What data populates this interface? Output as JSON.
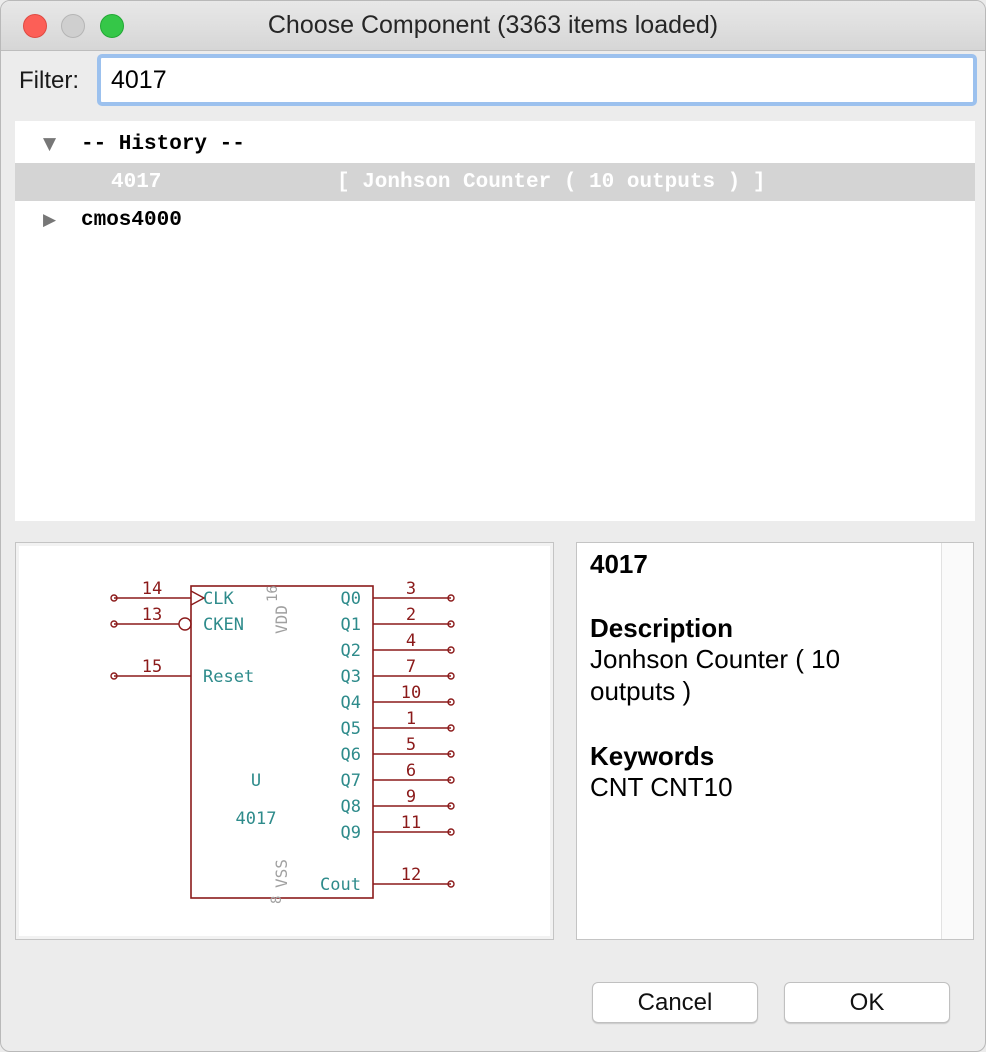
{
  "window": {
    "title": "Choose Component (3363 items loaded)"
  },
  "filter": {
    "label": "Filter:",
    "value": "4017"
  },
  "tree": {
    "history_label": "-- History --",
    "history_item": {
      "name": "4017",
      "description": "[ Jonhson Counter ( 10 outputs ) ]"
    },
    "library_label": "cmos4000"
  },
  "symbol": {
    "reference": "U",
    "value": "4017",
    "power_pins": {
      "vdd_name": "VDD",
      "vdd_number": "16",
      "vss_name": "VSS",
      "vss_number": "8"
    },
    "left_pins": [
      {
        "number": "14",
        "name": "CLK"
      },
      {
        "number": "13",
        "name": "CKEN"
      },
      {
        "number": "15",
        "name": "Reset"
      }
    ],
    "right_pins": [
      {
        "number": "3",
        "name": "Q0"
      },
      {
        "number": "2",
        "name": "Q1"
      },
      {
        "number": "4",
        "name": "Q2"
      },
      {
        "number": "7",
        "name": "Q3"
      },
      {
        "number": "10",
        "name": "Q4"
      },
      {
        "number": "1",
        "name": "Q5"
      },
      {
        "number": "5",
        "name": "Q6"
      },
      {
        "number": "6",
        "name": "Q7"
      },
      {
        "number": "9",
        "name": "Q8"
      },
      {
        "number": "11",
        "name": "Q9"
      },
      {
        "number": "12",
        "name": "Cout"
      }
    ],
    "colors": {
      "body": "#8b1a1a",
      "pin_name": "#2e8b8b",
      "pin_number": "#8b1a1a",
      "power": "#a0a0a0"
    }
  },
  "details": {
    "name": "4017",
    "description_heading": "Description",
    "description": "Jonhson Counter ( 10 outputs )",
    "keywords_heading": "Keywords",
    "keywords": "CNT CNT10"
  },
  "buttons": {
    "cancel": "Cancel",
    "ok": "OK"
  }
}
